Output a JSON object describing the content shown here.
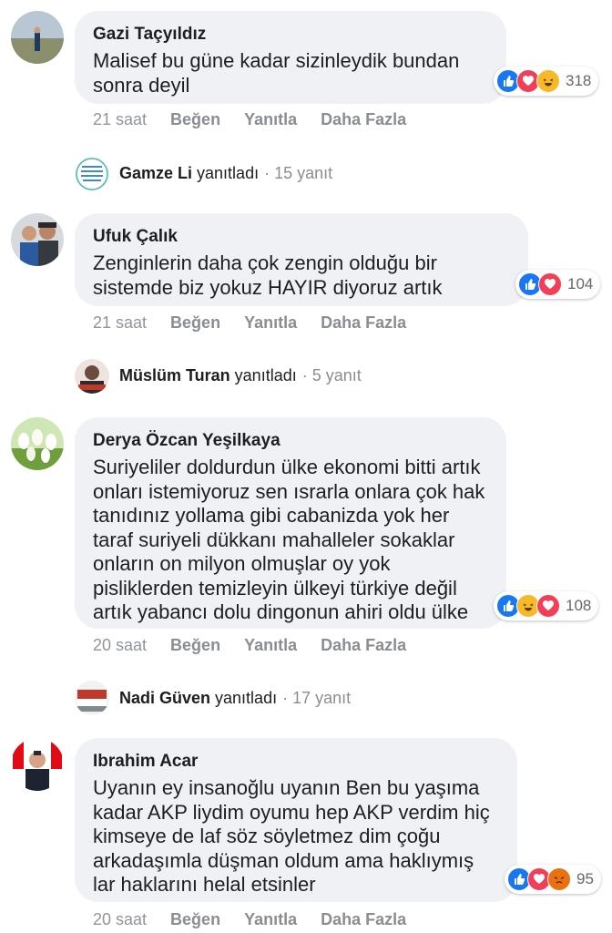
{
  "comments": [
    {
      "author": "Gazi Taçyıldız",
      "text": "Malisef bu güne kadar sizinleydik bundan sonra deyil",
      "reaction_count": "318",
      "reactions": [
        "like-icon",
        "love-icon",
        "haha-icon"
      ],
      "time": "21 saat",
      "like_label": "Beğen",
      "reply_label": "Yanıtla",
      "more_label": "Daha Fazla",
      "reply_summary": {
        "name": "Gamze Li",
        "verb": "yanıtladı",
        "count": "· 15 yanıt"
      }
    },
    {
      "author": "Ufuk Çalık",
      "text": "Zenginlerin daha çok zengin olduğu bir sistemde biz yokuz HAYIR diyoruz artık",
      "reaction_count": "104",
      "reactions": [
        "like-icon",
        "love-icon"
      ],
      "time": "21 saat",
      "like_label": "Beğen",
      "reply_label": "Yanıtla",
      "more_label": "Daha Fazla",
      "reply_summary": {
        "name": "Müslüm Turan",
        "verb": "yanıtladı",
        "count": "· 5 yanıt"
      }
    },
    {
      "author": "Derya Özcan Yeşilkaya",
      "text": "Suriyeliler doldurdun ülke ekonomi bitti artık onları istemiyoruz sen ısrarla onlara çok hak tanıdınız yollama gibi cabanizda yok her taraf suriyeli dükkanı mahalleler sokaklar onların on milyon olmuşlar oy yok pisliklerden temizleyin ülkeyi türkiye değil artık yabancı dolu dingonun ahiri oldu ülke",
      "reaction_count": "108",
      "reactions": [
        "like-icon",
        "haha-icon",
        "love-icon"
      ],
      "time": "20 saat",
      "like_label": "Beğen",
      "reply_label": "Yanıtla",
      "more_label": "Daha Fazla",
      "reply_summary": {
        "name": "Nadi Güven",
        "verb": "yanıtladı",
        "count": "· 17 yanıt"
      }
    },
    {
      "author": "Ibrahim Acar",
      "text": "Uyanın ey insanoğlu uyanın Ben bu yaşıma kadar AKP liydim oyumu hep AKP verdim hiç kimseye de laf söz söyletmez dim çoğu arkadaşımla düşman oldum ama haklıymış lar haklarını helal etsinler",
      "reaction_count": "95",
      "reactions": [
        "like-icon",
        "love-icon",
        "angry-icon"
      ],
      "time": "20 saat",
      "like_label": "Beğen",
      "reply_label": "Yanıtla",
      "more_label": "Daha Fazla"
    }
  ],
  "colors": {
    "bubble": "#f0f1f4",
    "like": "#1877f2",
    "love": "#f33e58",
    "haha": "#f7b928",
    "angry": "#e9710f",
    "meta": "#8a8d91"
  }
}
